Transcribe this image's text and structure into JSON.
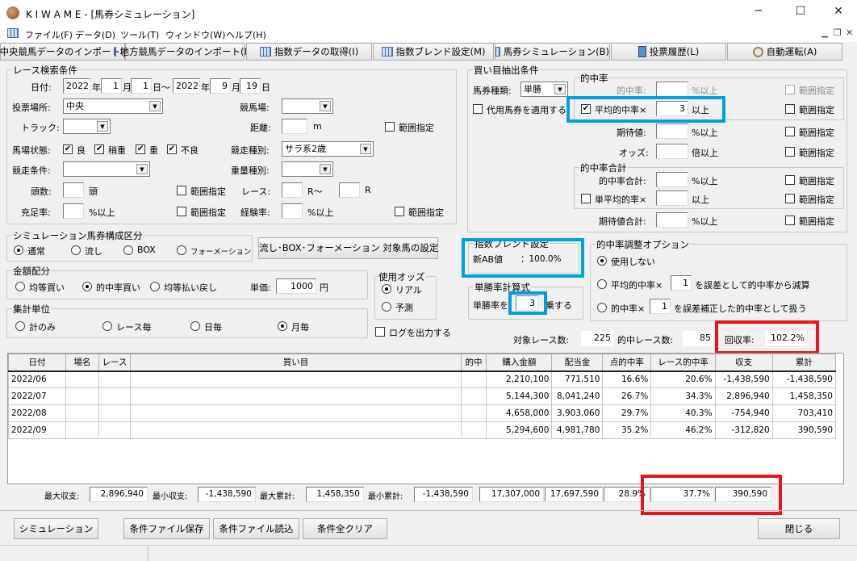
{
  "window": {
    "title": "K I W A M E - [馬券シミュレーション]",
    "minimize": "─",
    "maximize": "☐",
    "close": "✕"
  },
  "menu": [
    "ファイル(F)",
    "データ(D)",
    "ツール(T)",
    "ウィンドウ(W)",
    "ヘルプ(H)"
  ],
  "toolbar": [
    "中央競馬データのインポート(J)",
    "地方競馬データのインポート(N)",
    "指数データの取得(I)",
    "指数ブレンド設定(M)",
    "馬券シミュレーション(B)",
    "投票履歴(L)",
    "自動運転(A)"
  ],
  "race": {
    "title": "レース検索条件",
    "date_label": "日付:",
    "from_year": "2022",
    "year": "年",
    "from_month": "1",
    "month": "月",
    "from_day": "1",
    "day_tilde": "日～",
    "to_year": "2022",
    "to_month": "9",
    "to_day": "19",
    "day": "日",
    "venue_label": "投票場所:",
    "venue": "中央",
    "course_label": "競馬場:",
    "course": "",
    "track_label": "トラック:",
    "distance_label": "距離:",
    "distance_unit": "m",
    "range": "範囲指定",
    "ground_label": "馬場状態:",
    "ground": [
      "良",
      "稍重",
      "重",
      "不良"
    ],
    "type_label": "競走種別:",
    "type": "サラ系2歳",
    "cond_label": "競走条件:",
    "weight_label": "重量種別:",
    "heads_label": "頭数:",
    "heads_unit": "頭",
    "race_label": "レース:",
    "race_from_unit": "R～",
    "race_to_unit": "R",
    "fill_label": "充足率:",
    "pct_over": "%以上",
    "exp_label": "経験率:"
  },
  "buy": {
    "title": "買い目抽出条件",
    "ticket_label": "馬券種類:",
    "ticket": "単勝",
    "substitute": "代用馬券を適用する",
    "hit_title": "的中率",
    "hit_label": "的中率:",
    "pct_over": "%以上",
    "avg_label": "平均的中率×",
    "avg_value": "3",
    "over": "以上",
    "range": "範囲指定",
    "ev_label": "期待値:",
    "odds_label": "オッズ:",
    "odds_unit": "倍以上",
    "sum_title": "的中率合計",
    "sum_label": "的中率合計:",
    "single_avg_label": "単平均的率×",
    "ev_sum_label": "期待値合計:"
  },
  "sim": {
    "title": "シミュレーション馬券構成区分",
    "options": [
      "通常",
      "流し",
      "BOX",
      "フォーメーション"
    ],
    "setting_button": "流し･BOX･フォーメーション 対象馬の設定"
  },
  "amount": {
    "title": "金額配分",
    "options": [
      "均等買い",
      "的中率買い",
      "均等払い戻し"
    ],
    "unit_label": "単価:",
    "unit_value": "1000",
    "yen": "円"
  },
  "odds": {
    "title": "使用オッズ",
    "options": [
      "リアル",
      "予測"
    ]
  },
  "agg": {
    "title": "集計単位",
    "options": [
      "計のみ",
      "レース毎",
      "日毎",
      "月毎"
    ]
  },
  "log": "ログを出力する",
  "blend": {
    "title": "指数ブレンド設定",
    "label": "新AB値",
    "value": "：100.0%"
  },
  "win": {
    "title": "単勝率計算式",
    "prefix": "単勝率を",
    "value": "3",
    "suffix": "乗する"
  },
  "adjust": {
    "title": "的中率調整オプション",
    "opt1": "使用しない",
    "opt2_a": "平均的中率×",
    "opt2_v": "1",
    "opt2_b": "を誤差として的中率から減算",
    "opt3_a": "的中率×",
    "opt3_v": "1",
    "opt3_b": "を誤差補正した的中率として扱う"
  },
  "stats": {
    "races_label": "対象レース数:",
    "races": "225",
    "hits_label": "的中レース数:",
    "hits": "85",
    "return_label": "回収率:",
    "return": "102.2%"
  },
  "table": {
    "headers": [
      "日付",
      "場名",
      "レース",
      "買い目",
      "的中",
      "購入金額",
      "配当金",
      "点的中率",
      "レース的中率",
      "収支",
      "累計"
    ],
    "rows": [
      [
        "2022/06",
        "",
        "",
        "",
        "",
        "2,210,100",
        "771,510",
        "16.6%",
        "20.6%",
        "-1,438,590",
        "-1,438,590"
      ],
      [
        "2022/07",
        "",
        "",
        "",
        "",
        "5,144,300",
        "8,041,240",
        "26.7%",
        "34.3%",
        "2,896,940",
        "1,458,350"
      ],
      [
        "2022/08",
        "",
        "",
        "",
        "",
        "4,658,000",
        "3,903,060",
        "29.7%",
        "40.3%",
        "-754,940",
        "703,410"
      ],
      [
        "2022/09",
        "",
        "",
        "",
        "",
        "5,294,600",
        "4,981,780",
        "35.2%",
        "46.2%",
        "-312,820",
        "390,590"
      ]
    ]
  },
  "summary": {
    "max_income_label": "最大収支:",
    "max_income": "2,896,940",
    "min_income_label": "最小収支:",
    "min_income": "-1,438,590",
    "max_cum_label": "最大累計:",
    "max_cum": "1,458,350",
    "min_cum_label": "最小累計:",
    "min_cum": "-1,438,590",
    "total_buy": "17,307,000",
    "total_pay": "17,697,590",
    "point_hit": "28.9%",
    "race_hit": "37.7%",
    "total_income": "390,590"
  },
  "buttons": {
    "simulate": "シミュレーション",
    "save": "条件ファイル保存",
    "load": "条件ファイル読込",
    "clear": "条件全クリア",
    "close": "閉じる"
  }
}
